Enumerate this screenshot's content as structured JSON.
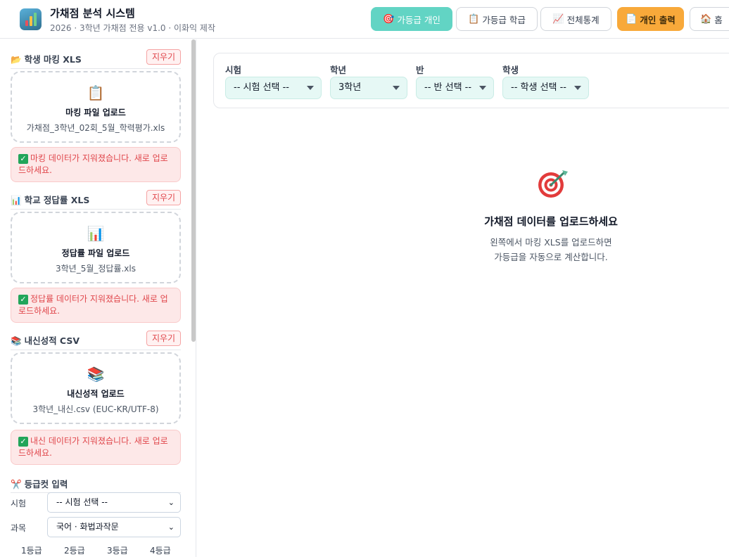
{
  "header": {
    "title": "가채점 분석 시스템",
    "subtitle": "2026 · 3학년 가채점 전용 v1.0 · 이화익 제작",
    "logo_icon": "bar-chart-icon",
    "nav": [
      {
        "icon": "🎯",
        "label": "가등급 개인",
        "state": "active"
      },
      {
        "icon": "📋",
        "label": "가등급 학급",
        "state": "normal"
      },
      {
        "icon": "📈",
        "label": "전체통계",
        "state": "normal"
      },
      {
        "icon": "📄",
        "label": "개인 출력",
        "state": "accent"
      },
      {
        "icon": "🏠",
        "label": "홈",
        "state": "normal"
      }
    ],
    "colors": {
      "active": "#62d4c4",
      "accent": "#f8a93a"
    }
  },
  "sidebar": {
    "sections": [
      {
        "icon": "📂",
        "title": "학생 마킹 XLS",
        "clear_label": "지우기",
        "drop_icon": "📋",
        "drop_title": "마킹 파일 업로드",
        "drop_file": "가채점_3학년_02회_5월_학력평가.xls",
        "alert": "마킹 데이터가 지워졌습니다. 새로 업로드하세요."
      },
      {
        "icon": "📊",
        "title": "학교 정답률 XLS",
        "clear_label": "지우기",
        "drop_icon": "📊",
        "drop_title": "정답률 파일 업로드",
        "drop_file": "3학년_5월_정답률.xls",
        "alert": "정답률 데이터가 지워졌습니다. 새로 업로드하세요."
      },
      {
        "icon": "📚",
        "title": "내신성적 CSV",
        "clear_label": "지우기",
        "drop_icon": "📚",
        "drop_title": "내신성적 업로드",
        "drop_file": "3학년_내신.csv (EUC-KR/UTF-8)",
        "alert": "내신 데이터가 지워졌습니다. 새로 업로드하세요."
      }
    ],
    "grade_cut": {
      "icon": "✂️",
      "title": "등급컷 입력",
      "exam_label": "시험",
      "exam_value": "-- 시험 선택 --",
      "subject_label": "과목",
      "subject_value": "국어 · 화법과작문",
      "grades": [
        "1등급",
        "2등급",
        "3등급",
        "4등급"
      ]
    }
  },
  "main": {
    "filters": [
      {
        "label": "시험",
        "value": "-- 시험 선택 --"
      },
      {
        "label": "학년",
        "value": "3학년"
      },
      {
        "label": "반",
        "value": "-- 반 선택 --"
      },
      {
        "label": "학생",
        "value": "-- 학생 선택 --"
      }
    ],
    "empty": {
      "icon": "target-icon",
      "title": "가채점 데이터를 업로드하세요",
      "line1": "왼쪽에서 마킹 XLS를 업로드하면",
      "line2": "가등급을 자동으로 계산합니다."
    }
  }
}
